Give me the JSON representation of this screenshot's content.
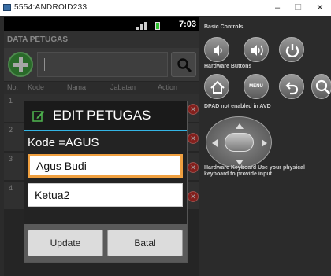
{
  "window": {
    "title": "5554:ANDROID233",
    "min_label": "–",
    "max_label": "☐",
    "close_label": "✕"
  },
  "status": {
    "time": "7:03"
  },
  "app": {
    "title": "DATA PETUGAS",
    "search": {
      "value": ""
    },
    "headers": [
      "No.",
      "Kode",
      "Nama",
      "Jabatan",
      "Action"
    ],
    "rows": [
      {
        "no": "1",
        "delete_label": "✕"
      },
      {
        "no": "2",
        "delete_label": "✕"
      },
      {
        "no": "3",
        "delete_label": "✕"
      },
      {
        "no": "4",
        "delete_label": "✕"
      }
    ]
  },
  "dialog": {
    "title": "EDIT PETUGAS",
    "kode_text": "Kode =AGUS",
    "nama_value": "Agus Budi",
    "jabatan_value": "Ketua2",
    "update_label": "Update",
    "cancel_label": "Batal"
  },
  "controls": {
    "basic_title": "Basic Controls",
    "hardware_title": "Hardware Buttons",
    "menu_label": "MENU",
    "dpad_title": "DPAD not enabled in AVD",
    "keyboard_text": "Hardware Keyboard Use your physical keyboard to provide input"
  },
  "colors": {
    "accent_blue": "#33b5e5",
    "focus_orange": "#f0a040",
    "add_green": "#3fa33f",
    "delete_red": "#c9302c"
  },
  "icons": [
    "add-icon",
    "search-icon",
    "edit-icon",
    "delete-icon",
    "volume-down-icon",
    "volume-up-icon",
    "power-icon",
    "home-icon",
    "back-icon"
  ]
}
